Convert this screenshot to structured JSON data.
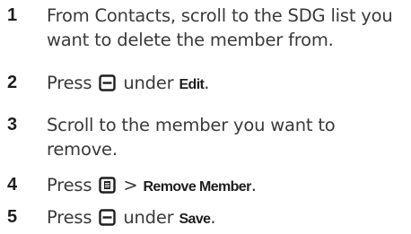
{
  "steps": [
    {
      "number": "1",
      "line1": "From Contacts, scroll to the SDG list you",
      "line2": "want to delete the member from."
    },
    {
      "number": "2",
      "pre": "Press",
      "icon": "soft-key-icon",
      "mid": "under",
      "keyword": "Edit",
      "post": "."
    },
    {
      "number": "3",
      "line1": "Scroll to the member you want to",
      "line2": "remove."
    },
    {
      "number": "4",
      "pre": "Press",
      "icon": "menu-key-icon",
      "sep": ">",
      "keyword": "Remove Member",
      "post": "."
    },
    {
      "number": "5",
      "pre": "Press",
      "icon": "soft-key-icon",
      "mid": "under",
      "keyword": "Save",
      "post": "."
    }
  ]
}
